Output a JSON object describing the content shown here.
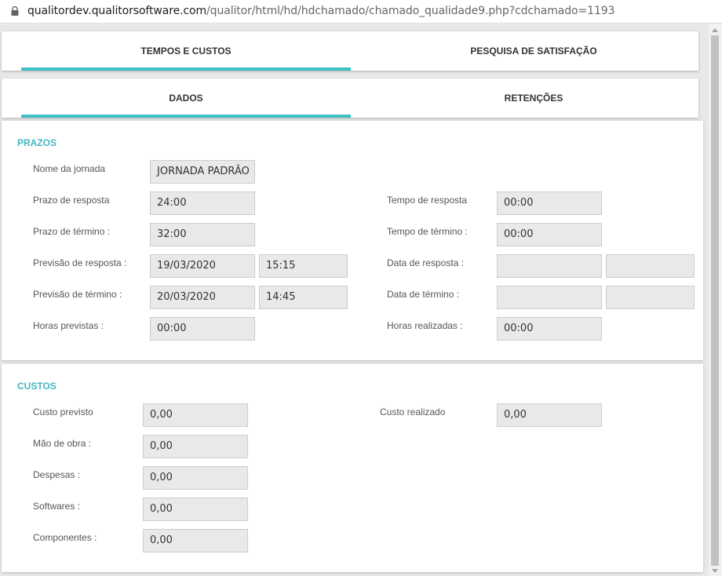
{
  "browser": {
    "url_host": "qualitordev.qualitorsoftware.com",
    "url_path": "/qualitor/html/hd/hdchamado/chamado_qualidade9.php?cdchamado=1193"
  },
  "tabs_top": [
    "TEMPOS E CUSTOS",
    "PESQUISA DE SATISFAÇÃO"
  ],
  "tabs_sub": [
    "DADOS",
    "RETENÇÕES"
  ],
  "prazos": {
    "title": "PRAZOS",
    "nome_jornada": {
      "label": "Nome da jornada",
      "value": "JORNADA PADRÃO"
    },
    "prazo_resposta": {
      "label": "Prazo de resposta",
      "value": "24:00"
    },
    "prazo_termino": {
      "label": "Prazo de término :",
      "value": "32:00"
    },
    "previsao_resposta": {
      "label": "Previsão de resposta :",
      "date": "19/03/2020",
      "time": "15:15"
    },
    "previsao_termino": {
      "label": "Previsão de término :",
      "date": "20/03/2020",
      "time": "14:45"
    },
    "horas_previstas": {
      "label": "Horas previstas :",
      "value": "00:00"
    },
    "tempo_resposta": {
      "label": "Tempo de resposta",
      "value": "00:00"
    },
    "tempo_termino": {
      "label": "Tempo de término :",
      "value": "00:00"
    },
    "data_resposta": {
      "label": "Data de resposta :",
      "date": "",
      "time": ""
    },
    "data_termino": {
      "label": "Data de término :",
      "date": "",
      "time": ""
    },
    "horas_realizadas": {
      "label": "Horas realizadas :",
      "value": "00:00"
    }
  },
  "custos": {
    "title": "CUSTOS",
    "custo_previsto": {
      "label": "Custo previsto",
      "value": "0,00"
    },
    "mao_de_obra": {
      "label": "Mão de obra :",
      "value": "0,00"
    },
    "despesas": {
      "label": "Despesas :",
      "value": "0,00"
    },
    "softwares": {
      "label": "Softwares :",
      "value": "0,00"
    },
    "componentes": {
      "label": "Componentes :",
      "value": "0,00"
    },
    "custo_realizado": {
      "label": "Custo realizado",
      "value": "0,00"
    }
  }
}
